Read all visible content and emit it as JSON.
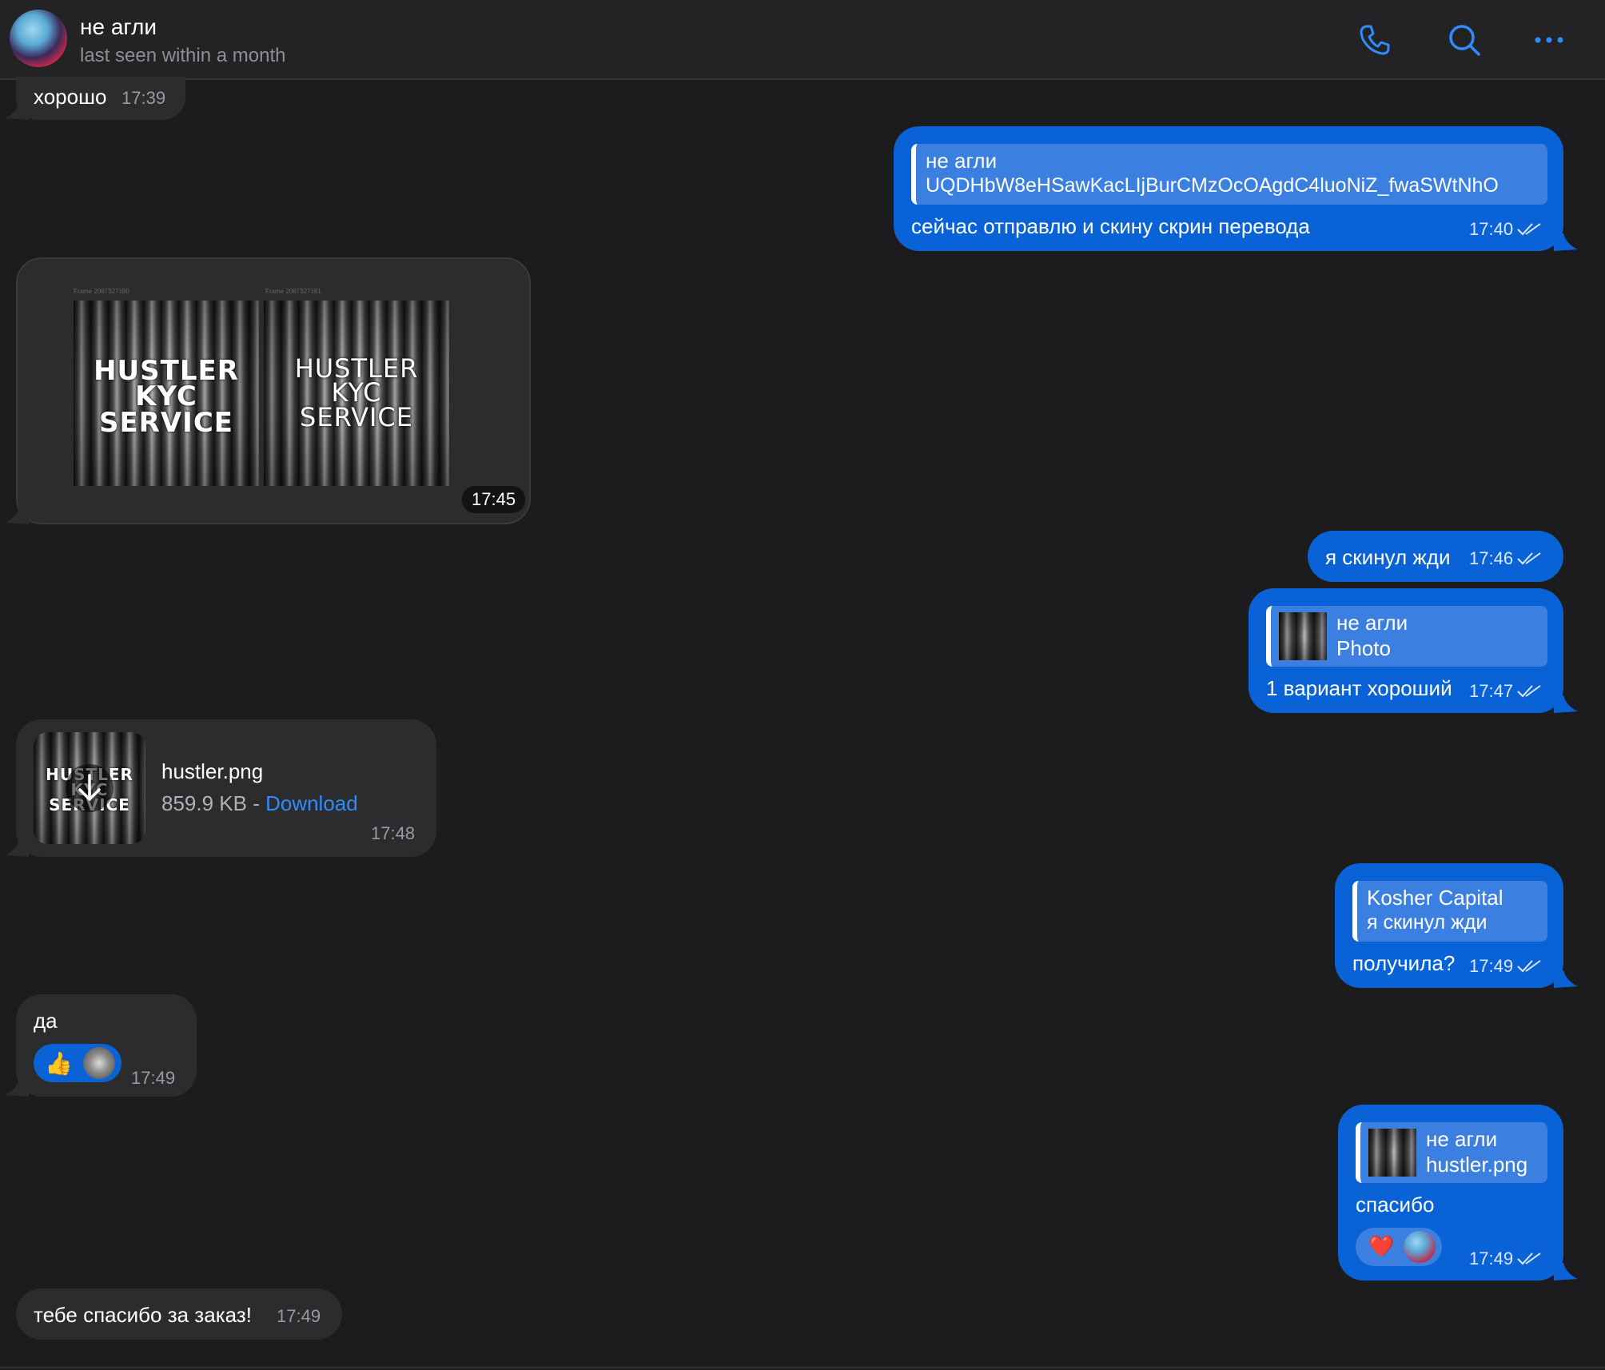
{
  "header": {
    "title": "не агли",
    "status": "last seen within a month",
    "call_icon": "phone-icon",
    "search_icon": "search-icon",
    "more_icon": "more-dots-icon"
  },
  "messages": {
    "m1": {
      "text": "хорошо",
      "time": "17:39"
    },
    "m2": {
      "reply_name": "не агли",
      "reply_text": "UQDHbW8eHSawKacLIjBurCMzOcOAgdC4luoNiZ_fwaSWtNhO",
      "text": "сейчас отправлю и скину скрин перевода",
      "time": "17:40"
    },
    "m3": {
      "frame_label_1": "Frame 2087327180",
      "frame_label_2": "Frame 2087327181",
      "art_text_1": "HUSTLER",
      "art_text_2": "KYC",
      "art_text_3": "SERVICE",
      "time": "17:45"
    },
    "m4": {
      "text": "я скинул жди",
      "time": "17:46"
    },
    "m5": {
      "reply_name": "не агли",
      "reply_text": "Photo",
      "text": "1 вариант хороший",
      "time": "17:47"
    },
    "m6": {
      "file_name": "hustler.png",
      "file_size": "859.9 KB - ",
      "download": "Download",
      "time": "17:48"
    },
    "m7": {
      "reply_name": "Kosher Capital",
      "reply_text": "я скинул жди",
      "text": "получила?",
      "time": "17:49"
    },
    "m8": {
      "text": "да",
      "reaction": "👍",
      "time": "17:49"
    },
    "m9": {
      "reply_name": "не агли",
      "reply_text": "hustler.png",
      "text": "спасибо",
      "reaction": "❤️",
      "time": "17:49"
    },
    "m10": {
      "text": "тебе спасибо за заказ!",
      "time": "17:49"
    }
  },
  "colors": {
    "background": "#1c1c1e",
    "incoming_bubble": "#2c2c2e",
    "outgoing_bubble": "#0a63d6",
    "accent": "#2f8cff"
  }
}
